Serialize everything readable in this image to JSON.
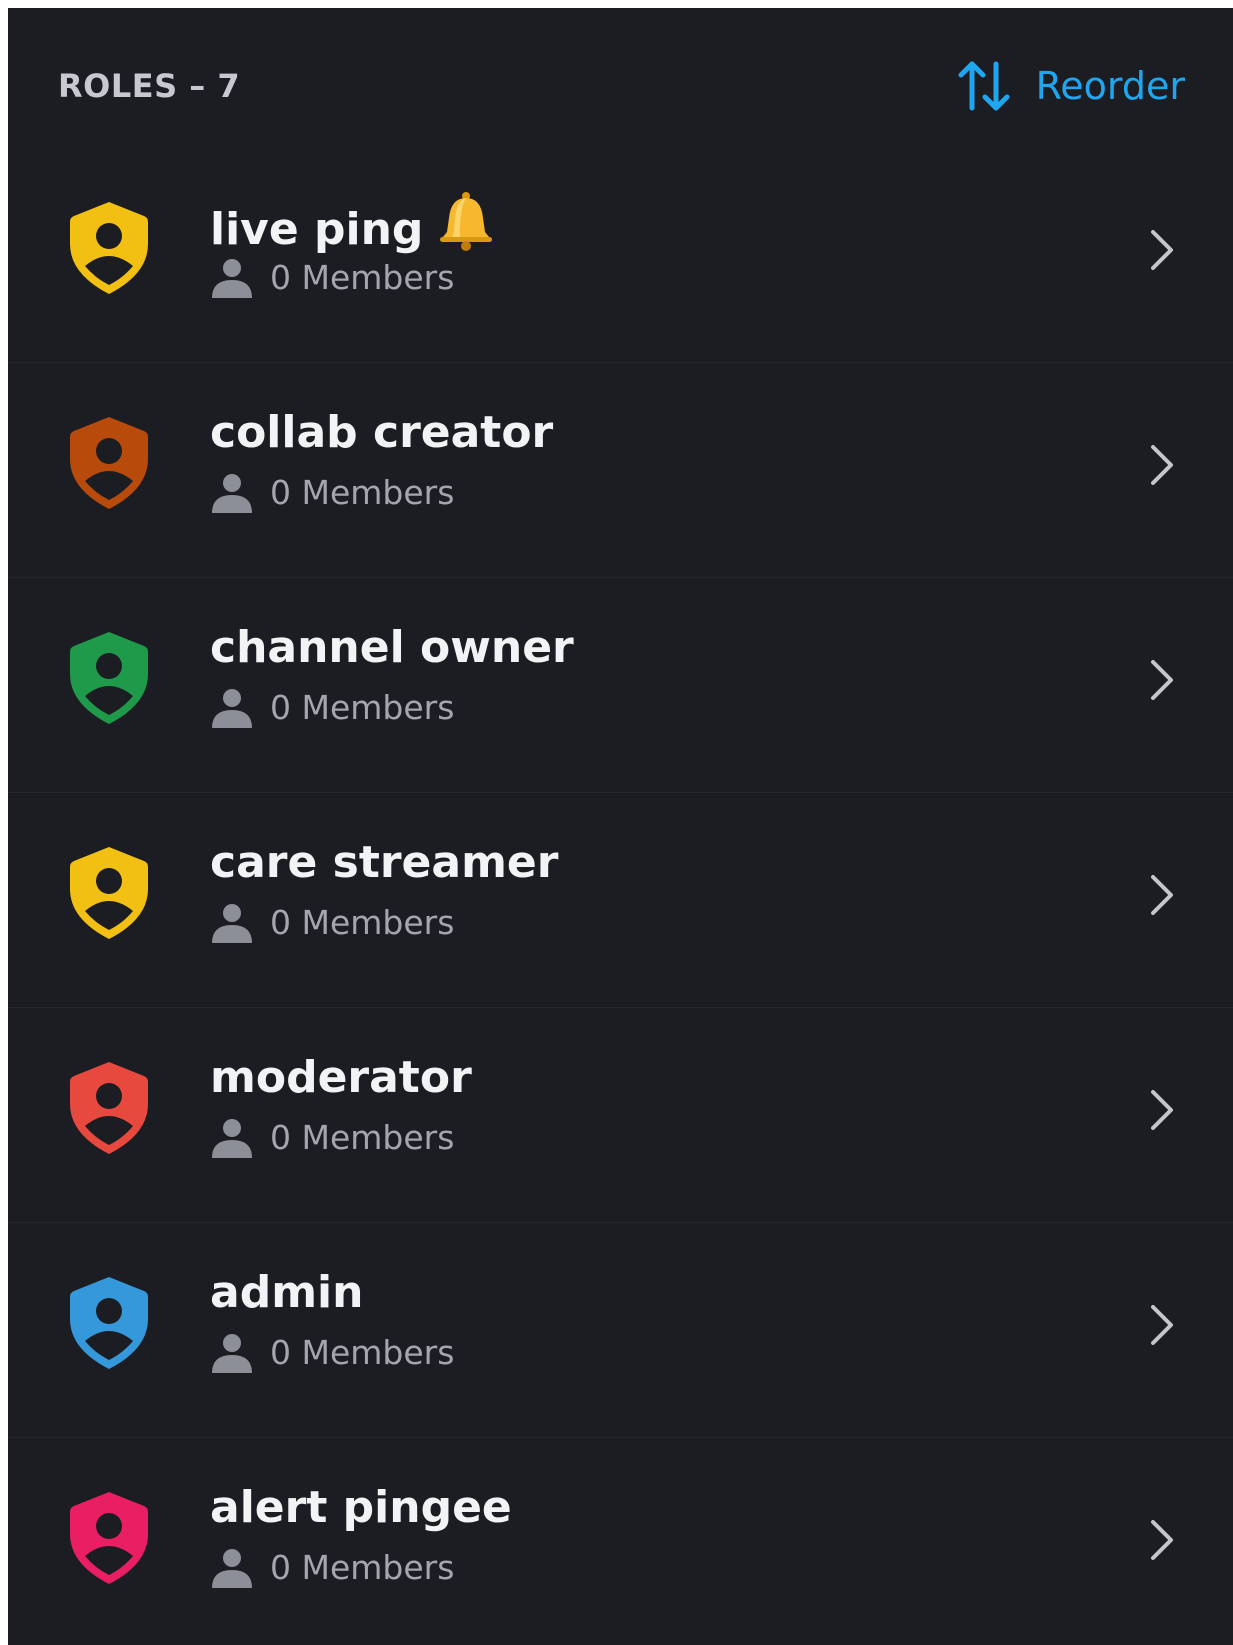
{
  "header": {
    "title": "ROLES – 7",
    "reorder_label": "Reorder",
    "reorder_icon": "sort-arrows-icon",
    "accent_color": "#1ea7f0"
  },
  "member_icon": "person-icon",
  "roles": [
    {
      "name": "live ping",
      "emoji": "bell-emoji-icon",
      "members": "0 Members",
      "color": "#f2c012"
    },
    {
      "name": "collab creator",
      "members": "0 Members",
      "color": "#b84a0c"
    },
    {
      "name": "channel owner",
      "members": "0 Members",
      "color": "#1f9a4a"
    },
    {
      "name": "care streamer",
      "members": "0 Members",
      "color": "#f2c012"
    },
    {
      "name": "moderator",
      "members": "0 Members",
      "color": "#e8493e"
    },
    {
      "name": "admin",
      "members": "0 Members",
      "color": "#3498db"
    },
    {
      "name": "alert pingee",
      "members": "0 Members",
      "color": "#e91e63"
    }
  ]
}
